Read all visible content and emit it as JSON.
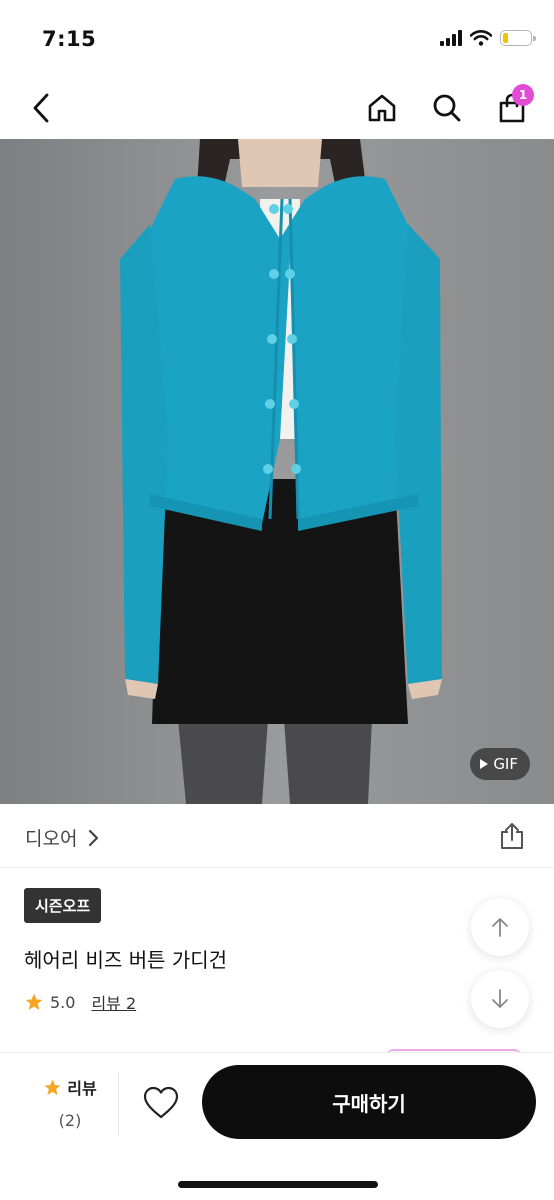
{
  "status": {
    "time": "7:15"
  },
  "nav": {
    "cart_count": "1"
  },
  "product": {
    "gif_label": "GIF",
    "brand": "디오어",
    "tag": "시즌오프",
    "title": "헤어리 비즈 버튼 가디건",
    "rating": "5.0",
    "review_link": "리뷰 2"
  },
  "bottom_bar": {
    "review_label": "리뷰",
    "review_count": "(2)",
    "buy_label": "구매하기"
  },
  "colors": {
    "accent_badge": "#e24cd4",
    "star": "#f5a623",
    "buy_button": "#0d0d0d",
    "cardigan": "#1aa3c4"
  },
  "icons": [
    "back-icon",
    "home-icon",
    "search-icon",
    "shopping-bag-icon",
    "play-icon",
    "chevron-right-icon",
    "share-icon",
    "arrow-up-icon",
    "arrow-down-icon",
    "star-icon",
    "heart-icon"
  ]
}
